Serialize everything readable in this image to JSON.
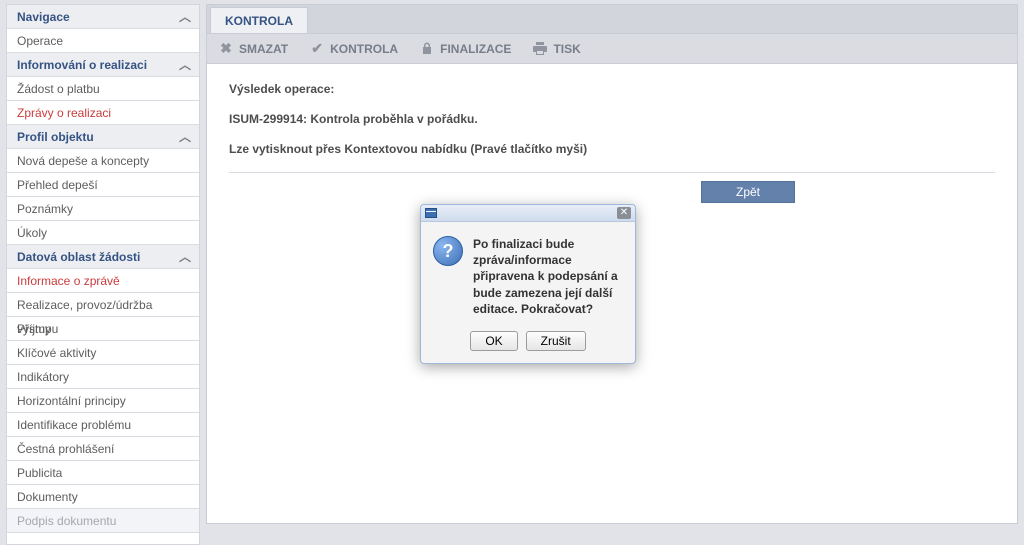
{
  "sidebar": {
    "groups": [
      {
        "label": "Navigace",
        "items": [
          "Operace"
        ]
      },
      {
        "label": "Informování o realizaci",
        "items": [
          "Žádost o platbu",
          {
            "label": "Zprávy o realizaci",
            "red": true
          }
        ]
      },
      {
        "label": "Profil objektu",
        "items": [
          "Nová depeše a koncepty",
          "Přehled depeší",
          "Poznámky",
          "Úkoly"
        ]
      },
      {
        "label": "Datová oblast žádosti",
        "items": [
          {
            "label": "Informace o zprávě",
            "red": true
          },
          "Realizace, provoz/údržba výstupu",
          "Příjmy",
          "Klíčové aktivity",
          "Indikátory",
          "Horizontální principy",
          "Identifikace problému",
          "Čestná prohlášení",
          "Publicita",
          "Dokumenty",
          {
            "label": "Podpis dokumentu",
            "disabled": true
          }
        ]
      }
    ]
  },
  "tab": {
    "label": "KONTROLA"
  },
  "toolbar": {
    "smazat": "SMAZAT",
    "kontrola": "KONTROLA",
    "finalizace": "FINALIZACE",
    "tisk": "TISK"
  },
  "content": {
    "result_label": "Výsledek operace:",
    "message": "ISUM-299914: Kontrola proběhla v pořádku.",
    "print_hint": "Lze vytisknout přes Kontextovou nabídku (Pravé tlačítko myši)",
    "back_label": "Zpět"
  },
  "dialog": {
    "text": "Po finalizaci bude zpráva/informace připravena k podepsání a bude zamezena její další editace. Pokračovat?",
    "ok": "OK",
    "cancel": "Zrušit"
  }
}
